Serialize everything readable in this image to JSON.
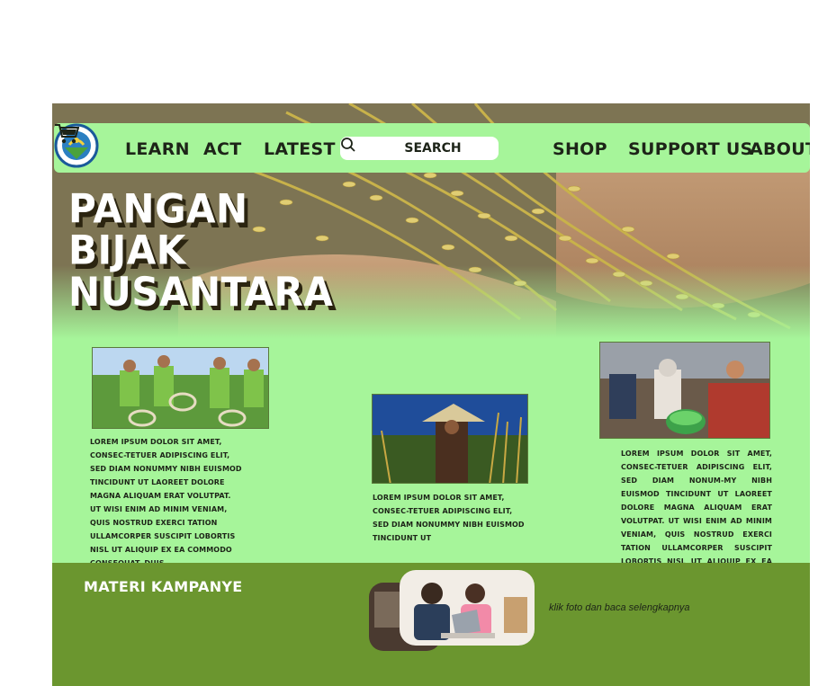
{
  "hero": {
    "title_line1": "PANGAN BIJAK",
    "title_line2": "NUSANTARA"
  },
  "nav": {
    "logo_icon": "organization-emblem-icon",
    "learn": "LEARN",
    "act": "ACT",
    "latest": "LATEST",
    "search_placeholder": "SEARCH",
    "shop": "SHOP",
    "support": "SUPPORT US",
    "about": "ABOUT",
    "cart_icon": "shopping-cart-icon"
  },
  "cards": [
    {
      "image": "volunteers-in-rice-field-photo",
      "text": "LOREM IPSUM DOLOR SIT AMET, CONSEC-TETUER ADIPISCING ELIT, SED DIAM NONUMMY NIBH EUISMOD TINCIDUNT UT LAOREET DOLORE MAGNA ALIQUAM ERAT VOLUTPAT. UT WISI ENIM AD MINIM VENIAM, QUIS NOSTRUD EXERCI TATION ULLAMCORPER SUSCIPIT LOBORTIS NISL UT ALIQUIP EX EA COMMODO CONSEQUAT. DUIS"
    },
    {
      "image": "farmer-in-conical-hat-photo",
      "text": "LOREM IPSUM DOLOR SIT AMET, CONSEC-TETUER ADIPISCING ELIT, SED DIAM NONUMMY NIBH EUISMOD TINCIDUNT UT"
    },
    {
      "image": "women-sorting-vegetables-photo",
      "text": "LOREM IPSUM DOLOR SIT AMET, CONSEC-TETUER ADIPISCING ELIT, SED DIAM NONUM-MY NIBH EUISMOD TINCIDUNT UT LAOREET DOLORE MAGNA ALIQUAM ERAT VOLUTPAT. UT WISI ENIM AD MINIM VENIAM, QUIS NOSTRUD EXERCI TATION ULLAMCORPER SUSCIPIT LOBORTIS NISL UT ALIQUIP EX EA COMMODO CONSEQUAT. DUIS AUTEM VEL"
    }
  ],
  "campaign": {
    "title": "MATERI KAMPANYE",
    "photo": "mother-and-child-with-laptop-photo",
    "caption": "klik foto dan baca selengkapnya"
  },
  "colors": {
    "nav_bg": "#a6f59a",
    "page_bg": "#a6f59a",
    "band_bg": "#6b962f",
    "text_dark": "#1d2418"
  }
}
